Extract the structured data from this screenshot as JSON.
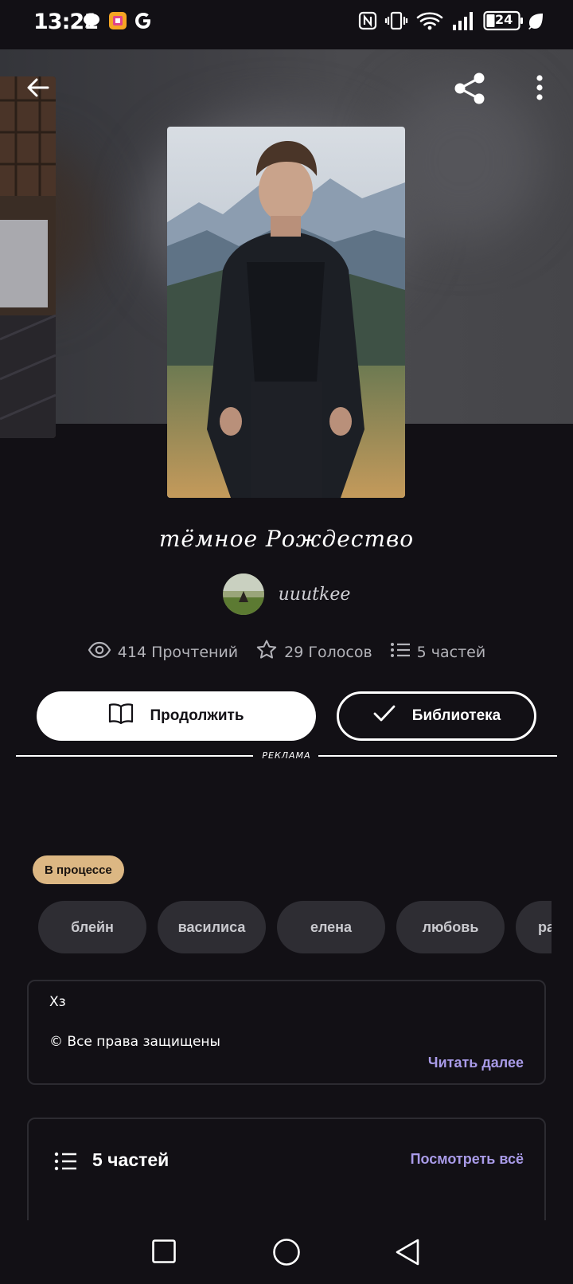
{
  "status_bar": {
    "time": "13:21",
    "battery": "24",
    "icons": [
      "chat-bubble-icon",
      "app-icon",
      "google-icon",
      "nfc-icon",
      "vibrate-icon",
      "wifi-icon",
      "signal-icon",
      "battery-icon",
      "leaf-icon"
    ]
  },
  "header": {
    "back_icon": "back-arrow-icon",
    "share_icon": "share-icon",
    "more_icon": "more-vertical-icon"
  },
  "story": {
    "title": "тёмное Рождество",
    "author": "uuutkee",
    "stats": {
      "reads": "414 Прочтений",
      "votes": "29 Голосов",
      "parts": "5 частей"
    }
  },
  "actions": {
    "continue_label": "Продолжить",
    "library_label": "Библиотека"
  },
  "ad": {
    "label": "РЕКЛАМА"
  },
  "status_badge": "В процессе",
  "tags": [
    "блейн",
    "василиса",
    "елена",
    "любовь",
    "ра"
  ],
  "description": {
    "line1": "Хз",
    "line2": "© Все права защищены",
    "read_more": "Читать далее"
  },
  "parts_section": {
    "title": "5 частей",
    "view_all": "Посмотреть всё"
  },
  "colors": {
    "background": "#121015",
    "accent_link": "#a99be8",
    "badge": "#dcb783",
    "tag_bg": "#2e2d33"
  }
}
